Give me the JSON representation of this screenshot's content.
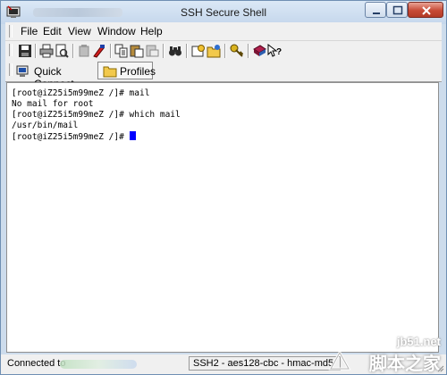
{
  "window": {
    "title": "SSH Secure Shell"
  },
  "menu": {
    "file": "File",
    "edit": "Edit",
    "view": "View",
    "window": "Window",
    "help": "Help"
  },
  "toolbar": {
    "icons": [
      "save-icon",
      "print-icon",
      "print-preview-icon",
      "paste-disabled-icon",
      "color-icon",
      "copy-icon",
      "paste-icon",
      "paste-keyboard-icon",
      "find-icon",
      "settings-icon",
      "profiles-icon",
      "key-icon",
      "help-book-icon",
      "context-help-icon"
    ]
  },
  "quickbar": {
    "quick_connect": "Quick Connect",
    "profiles": "Profiles"
  },
  "terminal": {
    "lines": [
      "[root@iZ25i5m99meZ /]# mail",
      "No mail for root",
      "[root@iZ25i5m99meZ /]# which mail",
      "/usr/bin/mail",
      "[root@iZ25i5m99meZ /]# "
    ]
  },
  "status": {
    "connection": "Connected to",
    "cipher": "SSH2 - aes128-cbc - hmac-md5"
  },
  "watermark": {
    "url": "jb51.net",
    "site": "脚本之家"
  },
  "colors": {
    "cursor": "#0000ff",
    "frame": "#cddcec",
    "close": "#c74a36"
  }
}
